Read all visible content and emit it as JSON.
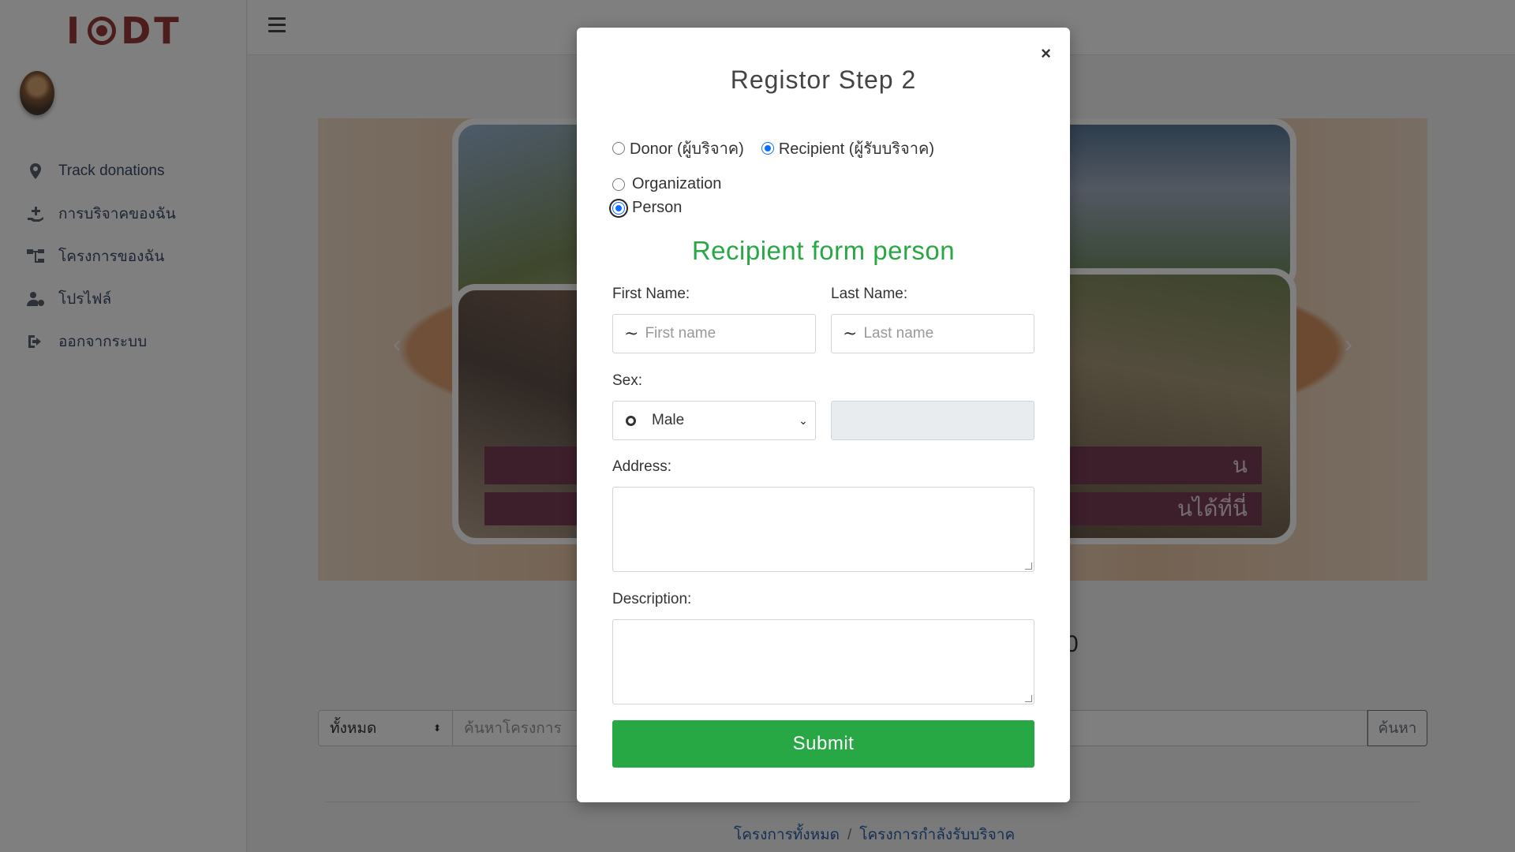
{
  "app": {
    "logo_text_left": "I",
    "logo_text_right": "DT"
  },
  "sidebar": {
    "items": [
      {
        "label": "Track donations",
        "icon": "map-pin-icon"
      },
      {
        "label": "การบริจาคของฉัน",
        "icon": "hand-donate-icon"
      },
      {
        "label": "โครงการของฉัน",
        "icon": "sitemap-icon"
      },
      {
        "label": "โปรไฟล์",
        "icon": "user-cog-icon"
      },
      {
        "label": "ออกจากระบบ",
        "icon": "logout-icon"
      }
    ]
  },
  "background": {
    "banner_line1": "น",
    "banner_line2": "นได้ที่นี่",
    "partial_heading": "0",
    "search": {
      "filter_value": "ทั้งหมด",
      "placeholder": "ค้นหาโครงการ",
      "button": "ค้นหา"
    },
    "breadcrumb": [
      "โครงการทั้งหมด",
      "โครงการกำลังรับบริจาค"
    ]
  },
  "modal": {
    "close": "×",
    "title": "Registor Step 2",
    "role_options": [
      {
        "label": "Donor (ผู้บริจาค)",
        "selected": false
      },
      {
        "label": "Recipient (ผู้รับบริจาค)",
        "selected": true
      }
    ],
    "type_options": [
      {
        "label": "Organization",
        "selected": false
      },
      {
        "label": "Person",
        "selected": true
      }
    ],
    "subtitle": "Recipient form person",
    "first_name": {
      "label": "First Name:",
      "placeholder": "First name"
    },
    "last_name": {
      "label": "Last Name:",
      "placeholder": "Last name"
    },
    "sex": {
      "label": "Sex:",
      "value": "Male"
    },
    "address": {
      "label": "Address:"
    },
    "description": {
      "label": "Description:"
    },
    "submit": "Submit"
  },
  "colors": {
    "accent_green": "#28a745",
    "radio_blue": "#0d6efd",
    "logo_red": "#9a3b3b",
    "banner_purple": "#7a3f56",
    "link_blue": "#2a5ca8"
  }
}
